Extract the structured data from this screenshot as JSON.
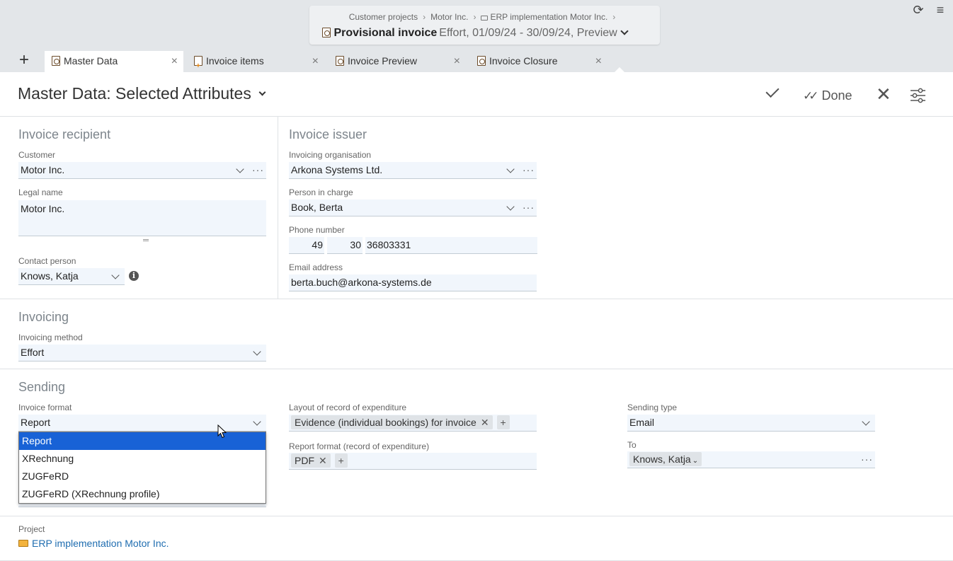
{
  "header": {
    "breadcrumb": [
      "Customer projects",
      "Motor Inc.",
      "ERP implementation Motor Inc."
    ],
    "title_strong": "Provisional invoice",
    "title_rest": "Effort, 01/09/24 - 30/09/24, Preview"
  },
  "tabs": [
    {
      "label": "Master Data",
      "icon": "invoice-icon"
    },
    {
      "label": "Invoice items",
      "icon": "invoice-items-icon"
    },
    {
      "label": "Invoice Preview",
      "icon": "invoice-icon"
    },
    {
      "label": "Invoice Closure",
      "icon": "invoice-icon"
    }
  ],
  "page": {
    "title": "Master Data: Selected Attributes",
    "done_label": "Done"
  },
  "recipient": {
    "title": "Invoice recipient",
    "customer_label": "Customer",
    "customer_value": "Motor Inc.",
    "legal_name_label": "Legal name",
    "legal_name_value": "Motor Inc.",
    "contact_label": "Contact person",
    "contact_value": "Knows, Katja"
  },
  "issuer": {
    "title": "Invoice issuer",
    "org_label": "Invoicing organisation",
    "org_value": "Arkona Systems Ltd.",
    "person_label": "Person in charge",
    "person_value": "Book, Berta",
    "phone_label": "Phone number",
    "phone_country": "49",
    "phone_area": "30",
    "phone_number": "36803331",
    "email_label": "Email address",
    "email_value": "berta.buch@arkona-systems.de"
  },
  "invoicing": {
    "title": "Invoicing",
    "method_label": "Invoicing method",
    "method_value": "Effort"
  },
  "sending": {
    "title": "Sending",
    "format_label": "Invoice format",
    "format_value": "Report",
    "format_options": [
      "Report",
      "XRechnung",
      "ZUGFeRD",
      "ZUGFeRD (XRechnung profile)"
    ],
    "layout_label": "Layout of record of expenditure",
    "layout_chip": "Evidence (individual bookings) for invoice",
    "report_format_label": "Report format (record of expenditure)",
    "report_format_chip": "PDF",
    "sending_type_label": "Sending type",
    "sending_type_value": "Email",
    "to_label": "To",
    "to_chip": "Knows, Katja"
  },
  "project": {
    "label": "Project",
    "value": "ERP implementation Motor Inc."
  },
  "colors": {
    "field_bg": "#f1f6fc",
    "selected": "#1862d6",
    "link": "#1f6db0",
    "topbar": "#e3e6e9"
  }
}
